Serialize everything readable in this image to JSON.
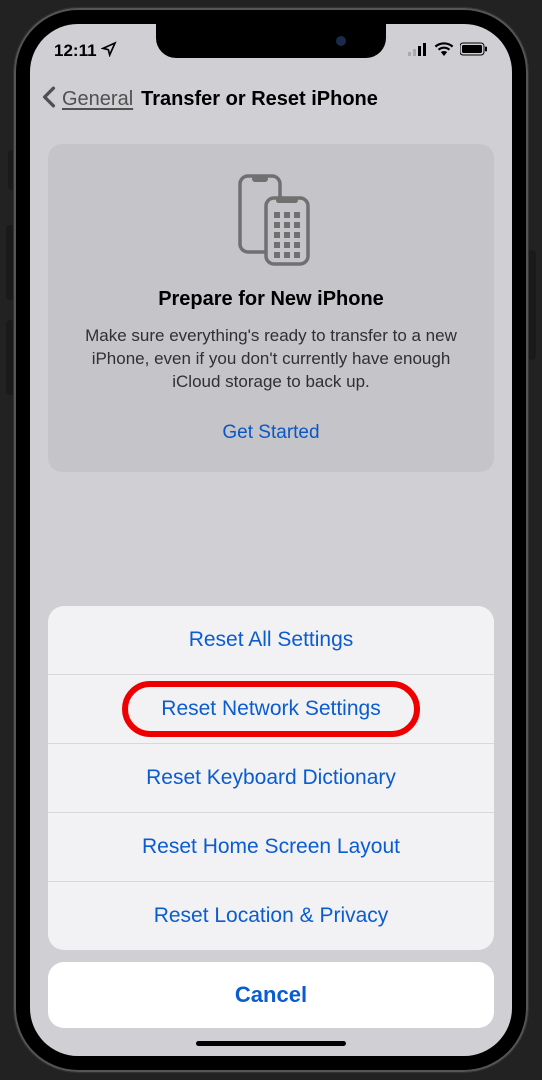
{
  "status": {
    "time": "12:11"
  },
  "nav": {
    "back_label": "General",
    "title": "Transfer or Reset iPhone"
  },
  "card": {
    "title": "Prepare for New iPhone",
    "description": "Make sure everything's ready to transfer to a new iPhone, even if you don't currently have enough iCloud storage to back up.",
    "cta": "Get Started"
  },
  "sheet": {
    "items": [
      "Reset All Settings",
      "Reset Network Settings",
      "Reset Keyboard Dictionary",
      "Reset Home Screen Layout",
      "Reset Location & Privacy"
    ],
    "cancel": "Cancel",
    "highlighted_index": 1
  }
}
